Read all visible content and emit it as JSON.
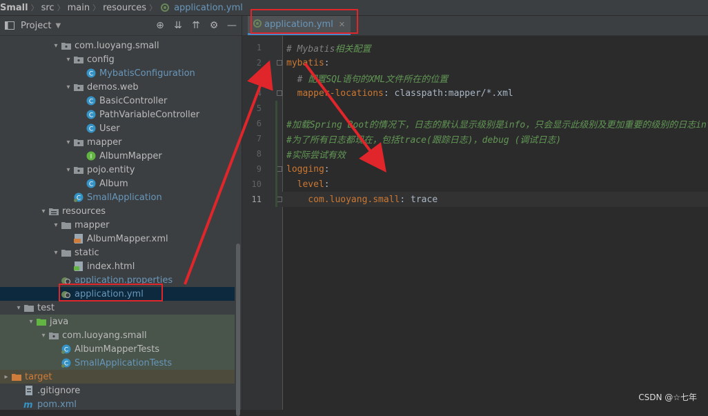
{
  "breadcrumb": [
    "Small",
    "src",
    "main",
    "resources",
    "application.yml"
  ],
  "project_panel": {
    "title": "Project",
    "tree": [
      {
        "label": "com.luoyang.small",
        "kind": "package",
        "indent": 4,
        "expanded": true
      },
      {
        "label": "config",
        "kind": "package",
        "indent": 5,
        "expanded": true
      },
      {
        "label": "MybatisConfiguration",
        "kind": "class",
        "indent": 6,
        "color": "blue"
      },
      {
        "label": "demos.web",
        "kind": "package",
        "indent": 5,
        "expanded": true
      },
      {
        "label": "BasicController",
        "kind": "class",
        "indent": 6
      },
      {
        "label": "PathVariableController",
        "kind": "class",
        "indent": 6
      },
      {
        "label": "User",
        "kind": "class",
        "indent": 6
      },
      {
        "label": "mapper",
        "kind": "package",
        "indent": 5,
        "expanded": true
      },
      {
        "label": "AlbumMapper",
        "kind": "interface",
        "indent": 6
      },
      {
        "label": "pojo.entity",
        "kind": "package",
        "indent": 5,
        "expanded": true
      },
      {
        "label": "Album",
        "kind": "class",
        "indent": 6
      },
      {
        "label": "SmallApplication",
        "kind": "springclass",
        "indent": 5,
        "color": "blue"
      },
      {
        "label": "resources",
        "kind": "resfolder",
        "indent": 3,
        "expanded": true
      },
      {
        "label": "mapper",
        "kind": "folder",
        "indent": 4,
        "expanded": true
      },
      {
        "label": "AlbumMapper.xml",
        "kind": "xml",
        "indent": 5
      },
      {
        "label": "static",
        "kind": "folder",
        "indent": 4,
        "expanded": true
      },
      {
        "label": "index.html",
        "kind": "html",
        "indent": 5
      },
      {
        "label": "application.properties",
        "kind": "spring",
        "indent": 4,
        "color": "blue"
      },
      {
        "label": "application.yml",
        "kind": "spring",
        "indent": 4,
        "color": "blue",
        "selected": true
      },
      {
        "label": "test",
        "kind": "folder",
        "indent": 1,
        "expanded": true
      },
      {
        "label": "java",
        "kind": "greenfolder",
        "indent": 2,
        "expanded": true,
        "bg": "test"
      },
      {
        "label": "com.luoyang.small",
        "kind": "package",
        "indent": 3,
        "expanded": true,
        "bg": "test"
      },
      {
        "label": "AlbumMapperTests",
        "kind": "springclass",
        "indent": 4,
        "bg": "test"
      },
      {
        "label": "SmallApplicationTests",
        "kind": "springclass",
        "indent": 4,
        "color": "blue",
        "bg": "test"
      },
      {
        "label": "target",
        "kind": "orangefolder",
        "indent": 0,
        "expanded": false,
        "color": "orange",
        "bg": "target"
      },
      {
        "label": ".gitignore",
        "kind": "file",
        "indent": 1
      },
      {
        "label": "pom.xml",
        "kind": "maven",
        "indent": 1,
        "color": "blue"
      }
    ]
  },
  "editor": {
    "tab_label": "application.yml",
    "lines": [
      {
        "n": "1",
        "segs": [
          {
            "t": "# Mybatis",
            "c": "cmt"
          },
          {
            "t": "相关配置",
            "c": "cmt-cn"
          }
        ]
      },
      {
        "n": "2",
        "segs": [
          {
            "t": "mybatis",
            "c": "key"
          },
          {
            "t": ":",
            "c": "val"
          }
        ]
      },
      {
        "n": "3",
        "segs": [
          {
            "t": "  # ",
            "c": "cmt"
          },
          {
            "t": "配置SQL语句的XML文件所在的位置",
            "c": "cmt-cn"
          }
        ]
      },
      {
        "n": "4",
        "segs": [
          {
            "t": "  mapper-locations",
            "c": "key"
          },
          {
            "t": ": classpath:mapper/*.xml",
            "c": "val"
          }
        ]
      },
      {
        "n": "5",
        "segs": []
      },
      {
        "n": "6",
        "segs": [
          {
            "t": "#加载Spring Boot的情况下，日志的默认显示级别是info，只会显示此级别及更加重要的级别的日志info",
            "c": "cmt-cn"
          }
        ]
      },
      {
        "n": "7",
        "segs": [
          {
            "t": "#为了所有日志都现在，包括trace(跟踪日志)，debug (调试日志)",
            "c": "cmt-cn"
          }
        ]
      },
      {
        "n": "8",
        "segs": [
          {
            "t": "#实际尝试有效",
            "c": "cmt-cn"
          }
        ]
      },
      {
        "n": "9",
        "segs": [
          {
            "t": "logging",
            "c": "key"
          },
          {
            "t": ":",
            "c": "val"
          }
        ]
      },
      {
        "n": "10",
        "segs": [
          {
            "t": "  level",
            "c": "key"
          },
          {
            "t": ":",
            "c": "val"
          }
        ]
      },
      {
        "n": "11",
        "segs": [
          {
            "t": "    com.luoyang.small",
            "c": "key"
          },
          {
            "t": ": trace",
            "c": "val"
          }
        ],
        "current": true
      }
    ]
  },
  "watermark": "CSDN @☆七年",
  "colors": {
    "highlight_box": "#e0262b",
    "arrow": "#e0262b",
    "accent": "#4a88c7"
  }
}
